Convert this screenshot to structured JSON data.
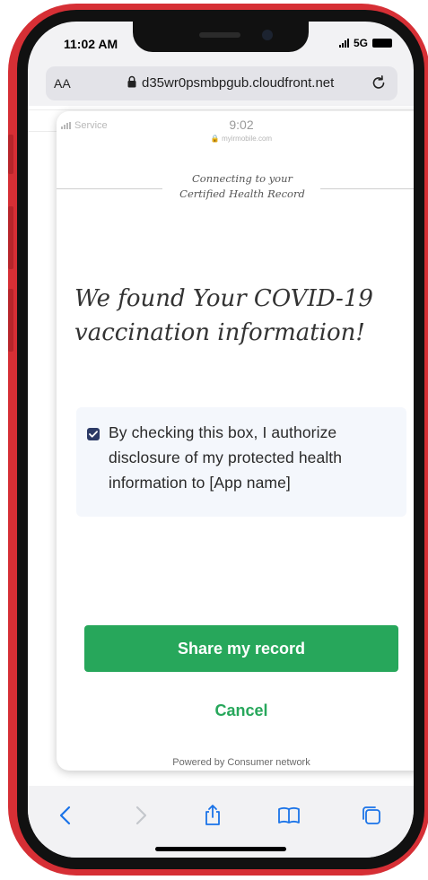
{
  "status_bar": {
    "time": "11:02 AM",
    "network": "5G"
  },
  "browser": {
    "text_size_label": "AA",
    "url": "d35wr0psmbpgub.cloudfront.net"
  },
  "inner_status": {
    "carrier": "Service",
    "time": "9:02",
    "url": "myirmobile.com"
  },
  "card": {
    "header_line1": "Connecting to your",
    "header_line2": "Certified Health Record",
    "headline_line1": "We found Your COVID-19",
    "headline_line2": "vaccination information!",
    "consent": {
      "checked": true,
      "line1": "By checking this box, I authorize",
      "line2": "disclosure of my protected health",
      "line3": "information to [App name]"
    },
    "share_button": "Share my record",
    "cancel_button": "Cancel",
    "powered_by": "Powered by Consumer network"
  },
  "toolbar": {
    "icons": [
      "back-icon",
      "forward-icon",
      "share-icon",
      "bookmarks-icon",
      "tabs-icon"
    ]
  },
  "colors": {
    "accent_green": "#27a75b",
    "phone_red": "#d62f35",
    "checkbox_navy": "#2c3a66",
    "toolbar_blue": "#1a73e8"
  }
}
